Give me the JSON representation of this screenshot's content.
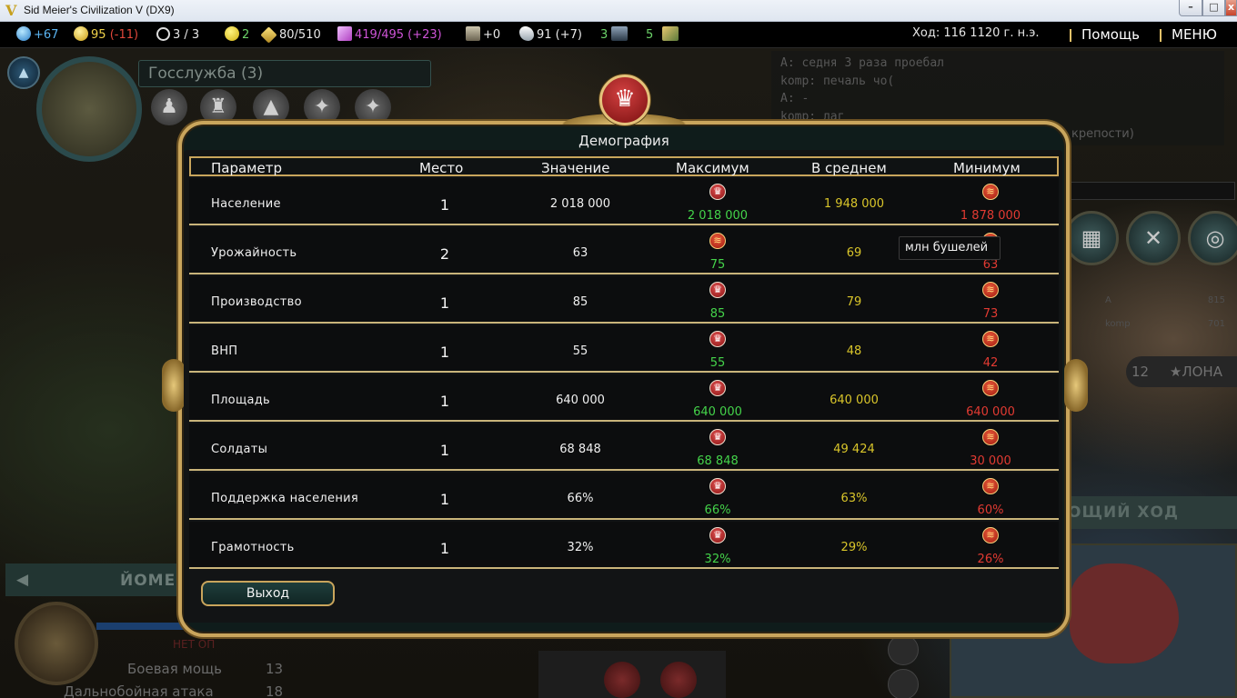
{
  "window": {
    "title": "Sid Meier's Civilization V (DX9)",
    "minimize": "–",
    "maximize": "□",
    "close": "x"
  },
  "topbar": {
    "science": "+67",
    "gold": "95",
    "gold_delta": "(-11)",
    "trade_routes": "3 / 3",
    "happiness": "2",
    "culture": "80/510",
    "faith": "419/495 (+23)",
    "strategic": "+0",
    "influence": "91 (+7)",
    "resource_a": "3",
    "resource_b": "5",
    "turn_label": "Ход: 116  1120 г. н.э.",
    "help": "Помощь",
    "menu": "МЕНЮ"
  },
  "background": {
    "policy_title": "Госслужба (3)",
    "chat_lines": [
      "A: седня 3 раза проебал",
      "komp: печаль чо(",
      "A: -",
      "komp: лаг"
    ],
    "chat_fortress": "крепости)",
    "scores": [
      {
        "name": "A",
        "score": "815"
      },
      {
        "name": "komp",
        "score": "701"
      }
    ],
    "unit_count": "12",
    "unit_count_label": "★ЛОНА",
    "next_turn": "ОЩИЙ ХОД",
    "unit_name": "ЙОМЕН",
    "no_upgrade": "НЕТ ОП",
    "combat_label": "Боевая мощь",
    "combat_value": "13",
    "ranged_label": "Дальнобойная атака",
    "ranged_value": "18"
  },
  "dialog": {
    "title": "Демография",
    "headers": [
      "Параметр",
      "Место",
      "Значение",
      "Максимум",
      "В среднем",
      "Минимум"
    ],
    "rows": [
      {
        "name": "Население",
        "rank": "1",
        "value": "2 018 000",
        "max": "2 018 000",
        "avg": "1 948 000",
        "min": "1 878 000"
      },
      {
        "name": "Урожайность",
        "rank": "2",
        "value": "63",
        "max": "75",
        "avg": "69",
        "min": "63"
      },
      {
        "name": "Производство",
        "rank": "1",
        "value": "85",
        "max": "85",
        "avg": "79",
        "min": "73"
      },
      {
        "name": "ВНП",
        "rank": "1",
        "value": "55",
        "max": "55",
        "avg": "48",
        "min": "42"
      },
      {
        "name": "Площадь",
        "rank": "1",
        "value": "640 000",
        "max": "640 000",
        "avg": "640 000",
        "min": "640 000"
      },
      {
        "name": "Солдаты",
        "rank": "1",
        "value": "68 848",
        "max": "68 848",
        "avg": "49 424",
        "min": "30 000"
      },
      {
        "name": "Поддержка населения",
        "rank": "1",
        "value": "66%",
        "max": "66%",
        "avg": "63%",
        "min": "60%"
      },
      {
        "name": "Грамотность",
        "rank": "1",
        "value": "32%",
        "max": "32%",
        "avg": "29%",
        "min": "26%"
      }
    ],
    "tooltip": "млн бушелей",
    "exit": "Выход"
  },
  "icons": {
    "crown": "♛",
    "max_civ": "♛",
    "min_civ": "≋"
  },
  "colors": {
    "accent_gold": "#c9a55c",
    "max_green": "#44d34a",
    "avg_yellow": "#d9c52a",
    "min_red": "#e23a32"
  }
}
